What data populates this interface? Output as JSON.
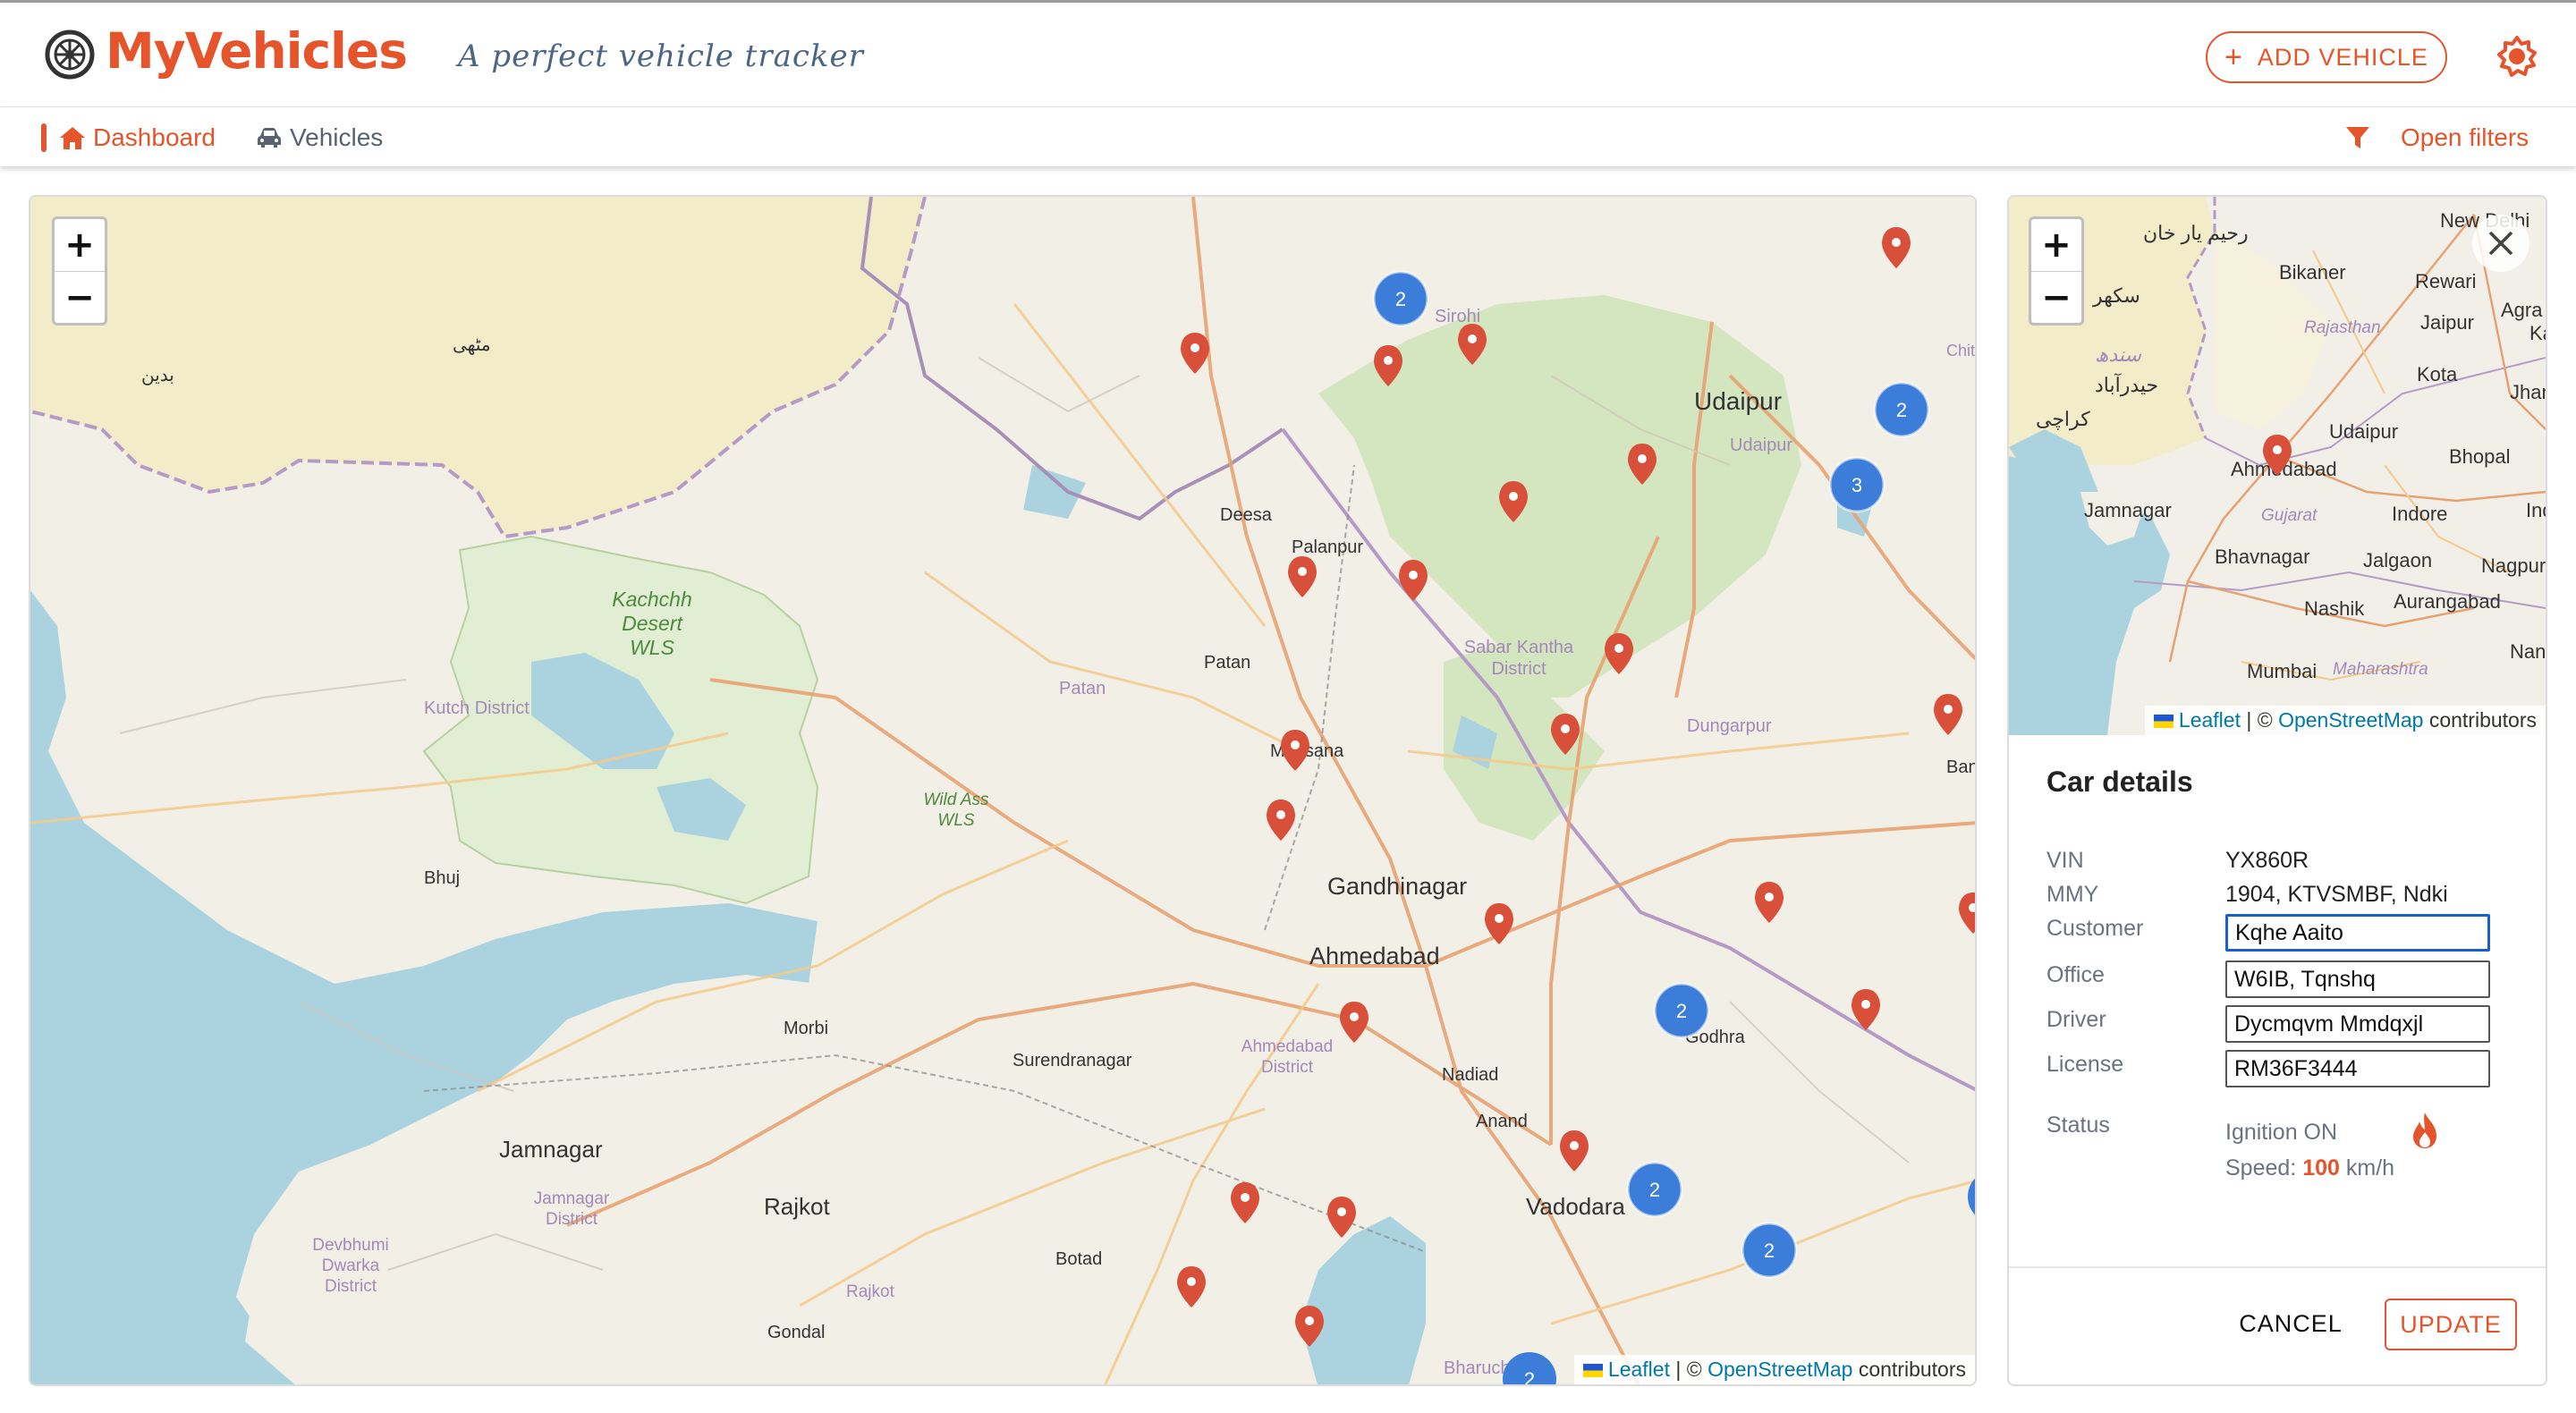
{
  "header": {
    "brand": "MyVehicles",
    "tagline": "A perfect vehicle tracker",
    "add_vehicle_label": "ADD VEHICLE"
  },
  "nav": {
    "dashboard": "Dashboard",
    "vehicles": "Vehicles",
    "open_filters": "Open filters"
  },
  "map": {
    "zoom_in": "+",
    "zoom_out": "−",
    "attribution_leaflet": "Leaflet",
    "attribution_sep": " | © ",
    "attribution_osm": "OpenStreetMap",
    "attribution_tail": " contributors",
    "places": {
      "udaipur": "Udaipur",
      "udaipur_district": "Udaipur",
      "sirohi": "Sirohi",
      "deesa": "Deesa",
      "palanpur": "Palanpur",
      "kachchh_1": "Kachchh",
      "kachchh_2": "Desert",
      "kachchh_3": "WLS",
      "patan": "Patan",
      "patan_district": "Patan",
      "sabar_1": "Sabar Kantha",
      "sabar_2": "District",
      "kutch": "Kutch District",
      "mehsana": "Mehsana",
      "wildass_1": "Wild Ass",
      "wildass_2": "WLS",
      "dungarpur": "Dungarpur",
      "bhuj": "Bhuj",
      "gandhinagar": "Gandhinagar",
      "ahmedabad": "Ahmedabad",
      "morbi": "Morbi",
      "surendranagar": "Surendranagar",
      "ahmedabad_d1": "Ahmedabad",
      "ahmedabad_d2": "District",
      "godhra": "Godhra",
      "nadiad": "Nadiad",
      "anand": "Anand",
      "jamnagar": "Jamnagar",
      "jamnagar_d1": "Jamnagar",
      "jamnagar_d2": "District",
      "rajkot": "Rajkot",
      "rajkot_d": "Rajkot",
      "vadodara": "Vadodara",
      "devbhumi_1": "Devbhumi",
      "devbhumi_2": "Dwarka",
      "devbhumi_3": "District",
      "botad": "Botad",
      "gondal": "Gondal",
      "bharuch": "Bharuch",
      "ban": "Ban",
      "chit": "Chit",
      "mithi": "مٹھی",
      "badin": "بدین"
    },
    "clusters": [
      "2",
      "2",
      "3",
      "2",
      "2",
      "2",
      "2"
    ]
  },
  "panel": {
    "mini_places": {
      "newdelhi": "New Delhi",
      "bikaner": "Bikaner",
      "rewari": "Rewari",
      "jaipur": "Jaipur",
      "agra": "Agra",
      "rajasthan": "Rajasthan",
      "kota": "Kota",
      "udaipur": "Udaipur",
      "ahmedabad": "Ahmedabad",
      "bhopal": "Bhopal",
      "jamnagar": "Jamnagar",
      "gujarat": "Gujarat",
      "indore": "Indore",
      "bhavnagar": "Bhavnagar",
      "jalgaon": "Jalgaon",
      "nagpur": "Nagpur",
      "nashik": "Nashik",
      "aurangabad": "Aurangabad",
      "mumbai": "Mumbai",
      "maharashtra": "Maharashtra",
      "nande": "Nande",
      "jhan": "Jhan",
      "ind": "Ind",
      "ka": "Ka",
      "rahim": "رحیم یار خان",
      "sukkur": "سکھر",
      "sindh": "سندھ",
      "hyderabad": "حیدرآباد",
      "karachi": "کراچی"
    },
    "title": "Car details",
    "labels": {
      "vin": "VIN",
      "mmy": "MMY",
      "customer": "Customer",
      "office": "Office",
      "driver": "Driver",
      "license": "License",
      "status": "Status"
    },
    "values": {
      "vin": "YX860R",
      "mmy": "1904, KTVSMBF, Ndki",
      "customer": "Kqhe Aaito",
      "office": "W6IB, Tqnshq",
      "driver": "Dycmqvm Mmdqxjl",
      "license": "RM36F3444",
      "ignition": "Ignition ON",
      "speed_label": "Speed:",
      "speed_value": "100",
      "speed_unit": "km/h"
    },
    "cancel_label": "CANCEL",
    "update_label": "UPDATE"
  },
  "colors": {
    "accent": "#e5542b",
    "link": "#0078a8",
    "cluster": "#3b7dd8",
    "marker": "#d9503a"
  }
}
